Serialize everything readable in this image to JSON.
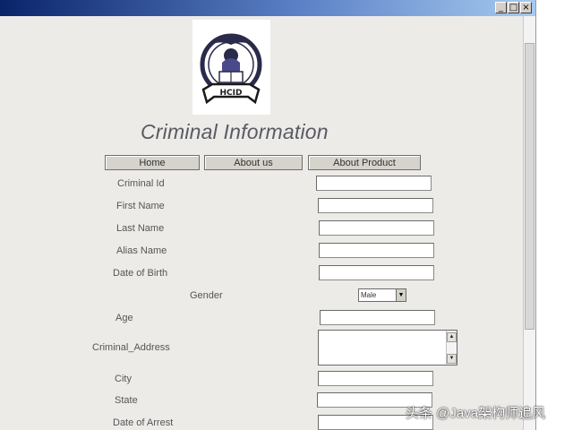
{
  "window": {
    "controls": {
      "minimize": "_",
      "maximize": "□",
      "close": "×"
    }
  },
  "page": {
    "title": "Criminal Information"
  },
  "nav": {
    "home": "Home",
    "about_us": "About us",
    "about_product": "About Product"
  },
  "form": {
    "criminal_id_label": "Criminal Id",
    "first_name_label": "First Name",
    "last_name_label": "Last Name",
    "alias_name_label": "Alias Name",
    "dob_label": "Date of Birth",
    "gender_label": "Gender",
    "gender_value": "Male",
    "age_label": "Age",
    "address_label": "Criminal_Address",
    "city_label": "City",
    "state_label": "State",
    "date_of_arrest_label": "Date of Arrest"
  },
  "logo": {
    "text": "HCID",
    "icon": "shield-book-emblem"
  },
  "watermark": {
    "text": "头条 @Java架构师追风"
  },
  "colors": {
    "titlebar_start": "#0a246a",
    "titlebar_end": "#a6caf0",
    "page_bg": "#ecebe8",
    "button_face": "#d6d3cc"
  }
}
